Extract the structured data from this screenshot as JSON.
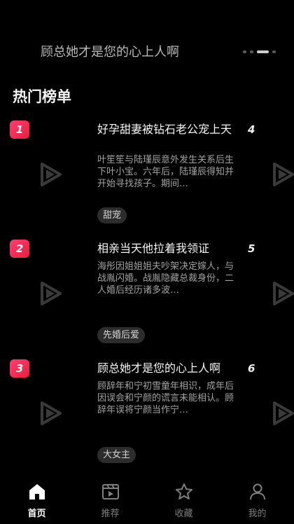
{
  "banner": {
    "title": "顾总她才是您的心上人啊",
    "dot_count": 4,
    "active_dot": 2
  },
  "section": {
    "title": "热门榜单"
  },
  "items": [
    {
      "rank": "1",
      "title": "好孕甜妻被钻石老公宠上天",
      "desc": "叶笙笙与陆瑾辰意外发生关系后生下叶小宝。六年后，陆瑾辰得知并开始寻找孩子。期间…",
      "tag": "甜宠",
      "next_rank": "4"
    },
    {
      "rank": "2",
      "title": "相亲当天他拉着我领证",
      "desc": "海彤因姐姐姐夫吵架决定嫁人，与战胤闪婚。战胤隐藏总裁身份，二人婚后经历诸多波…",
      "tag": "先婚后爱",
      "next_rank": "5"
    },
    {
      "rank": "3",
      "title": "顾总她才是您的心上人啊",
      "desc": "顾辞年和宁初雪童年相识，成年后因误会和宁颜的谎言未能相认。顾辞年误将宁颜当作宁…",
      "tag": "大女主",
      "next_rank": "6"
    }
  ],
  "tabs": [
    {
      "label": "首页",
      "icon": "home-icon",
      "active": true
    },
    {
      "label": "推荐",
      "icon": "film-icon",
      "active": false
    },
    {
      "label": "收藏",
      "icon": "star-icon",
      "active": false
    },
    {
      "label": "我的",
      "icon": "user-icon",
      "active": false
    }
  ]
}
